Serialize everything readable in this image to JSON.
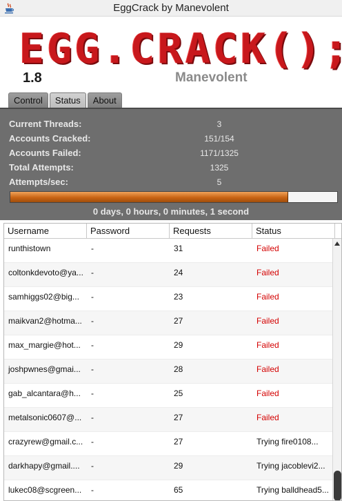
{
  "window": {
    "title": "EggCrack by Manevolent",
    "icon": "java-cup-icon"
  },
  "header": {
    "logo_text": "EGG.CRACK();",
    "version": "1.8",
    "author": "Manevolent"
  },
  "tabs": [
    {
      "label": "Control",
      "active": false
    },
    {
      "label": "Status",
      "active": true
    },
    {
      "label": "About",
      "active": false
    }
  ],
  "status": {
    "current_threads": {
      "label": "Current Threads:",
      "value": "3"
    },
    "accounts_cracked": {
      "label": "Accounts Cracked:",
      "value": "151/154"
    },
    "accounts_failed": {
      "label": "Accounts Failed:",
      "value": "1171/1325"
    },
    "total_attempts": {
      "label": "Total Attempts:",
      "value": "1325"
    },
    "attempts_per_sec": {
      "label": "Attempts/sec:",
      "value": "5"
    },
    "progress_fraction": 0.85,
    "elapsed": "0 days, 0 hours, 0 minutes, 1 second"
  },
  "table": {
    "columns": [
      "Username",
      "Password",
      "Requests",
      "Status"
    ],
    "rows": [
      {
        "username": "runthistown",
        "password": "-",
        "requests": "31",
        "status": "Failed"
      },
      {
        "username": "coltonkdevoto@ya...",
        "password": "-",
        "requests": "24",
        "status": "Failed"
      },
      {
        "username": "samhiggs02@big...",
        "password": "-",
        "requests": "23",
        "status": "Failed"
      },
      {
        "username": "maikvan2@hotma...",
        "password": "-",
        "requests": "27",
        "status": "Failed"
      },
      {
        "username": "max_margie@hot...",
        "password": "-",
        "requests": "29",
        "status": "Failed"
      },
      {
        "username": "joshpwnes@gmai...",
        "password": "-",
        "requests": "28",
        "status": "Failed"
      },
      {
        "username": "gab_alcantara@h...",
        "password": "-",
        "requests": "25",
        "status": "Failed"
      },
      {
        "username": "metalsonic0607@...",
        "password": "-",
        "requests": "27",
        "status": "Failed"
      },
      {
        "username": "crazyrew@gmail.c...",
        "password": "-",
        "requests": "27",
        "status": "Trying fire0108..."
      },
      {
        "username": "darkhapy@gmail....",
        "password": "-",
        "requests": "29",
        "status": "Trying jacoblevi2..."
      },
      {
        "username": "lukec08@scgreen...",
        "password": "-",
        "requests": "65",
        "status": "Trying balldhead5..."
      }
    ]
  },
  "colors": {
    "failed": "#d40000",
    "logo": "#c8181c",
    "panel": "#6e6e6e",
    "progress": "#c96414"
  }
}
